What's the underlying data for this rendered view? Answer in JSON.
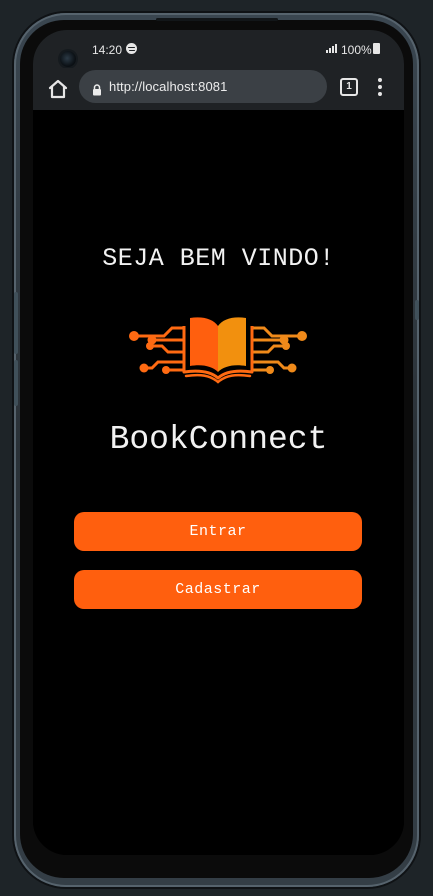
{
  "status_bar": {
    "time": "14:20",
    "battery": "100%"
  },
  "browser": {
    "url": "http://localhost:8081",
    "tab_count": "1"
  },
  "page": {
    "welcome_title": "SEJA BEM VINDO!",
    "app_name": "BookConnect",
    "enter_label": "Entrar",
    "register_label": "Cadastrar"
  },
  "colors": {
    "accent": "#ff5f0e",
    "logo_primary": "#ff5f0e",
    "logo_secondary": "#f08a1a",
    "background": "#000000",
    "text": "#f2f2f2"
  },
  "icons": {
    "status": [
      "spotify-icon",
      "signal-icon",
      "battery-icon"
    ],
    "browser": [
      "home-icon",
      "lock-icon",
      "tabs-icon",
      "menu-icon"
    ],
    "logo": "book-circuit-logo"
  }
}
